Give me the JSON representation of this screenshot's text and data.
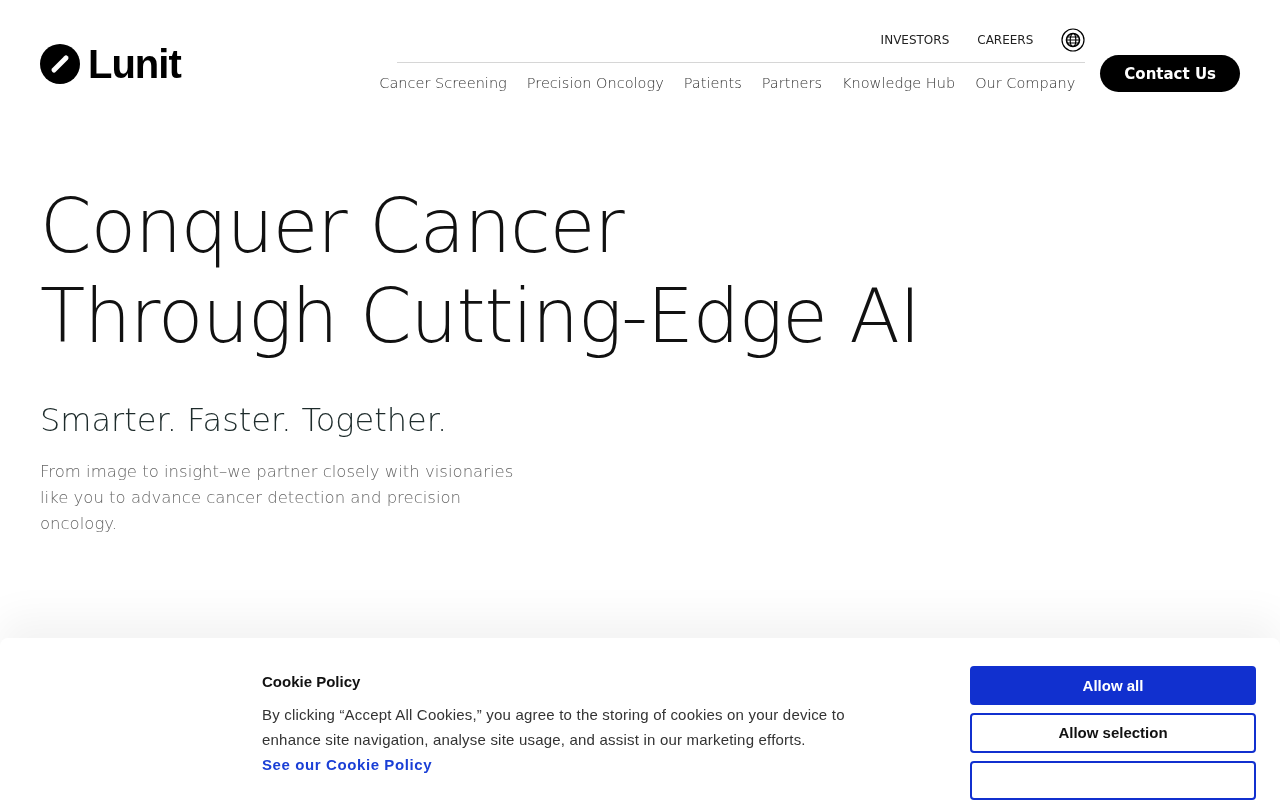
{
  "header": {
    "logo": "Lunit",
    "utility_links": [
      "INVESTORS",
      "CAREERS"
    ],
    "nav": [
      "Cancer Screening",
      "Precision Oncology",
      "Patients",
      "Partners",
      "Knowledge Hub",
      "Our Company"
    ],
    "cta": "Contact Us"
  },
  "hero": {
    "title_lines": [
      "Conquer Cancer",
      "Through Cutting-Edge AI"
    ],
    "tagline": "Smarter. Faster. Together.",
    "description": "From image to insight–we partner closely with visionaries like you to advance cancer detection and precision oncology."
  },
  "cookie_banner": {
    "title": "Cookie Policy",
    "text": "By clicking “Accept All Cookies,” you agree to the storing of cookies on your device to enhance site navigation, analyse site usage, and assist in our marketing efforts.",
    "link": "See our Cookie Policy",
    "buttons": [
      {
        "label": "Allow all",
        "kind": "primary"
      },
      {
        "label": "Allow selection",
        "kind": "outline"
      },
      {
        "kind": "outline"
      }
    ]
  }
}
